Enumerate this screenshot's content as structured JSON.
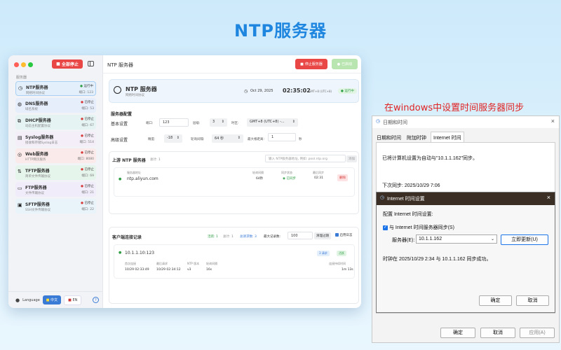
{
  "hero": {
    "title": "NTP服务器"
  },
  "caption": {
    "text": "在windows中设置时间服务器同步"
  },
  "mac": {
    "stop_all": "全部停止",
    "sidebar_heading": "服务器",
    "services": [
      {
        "name": "NTP服务器",
        "desc": "网络时间协议",
        "status": "运行中",
        "port": "端口: 123",
        "icon": "clock-icon",
        "color": "#2f9e44",
        "bg": "#e3f0fc"
      },
      {
        "name": "DNS服务器",
        "desc": "域名系统",
        "status": "已停止",
        "port": "端口: 53",
        "icon": "globe-icon",
        "color": "#d63b3b",
        "bg": "#e6eefb"
      },
      {
        "name": "DHCP服务器",
        "desc": "动态主机配置协议",
        "status": "已停止",
        "port": "端口: 67",
        "icon": "network-icon",
        "color": "#d63b3b",
        "bg": "#e5f3f3"
      },
      {
        "name": "Syslog服务器",
        "desc": "接收和存储Syslog日志",
        "status": "已停止",
        "port": "端口: 514",
        "icon": "document-icon",
        "color": "#d63b3b",
        "bg": "#f3eef8"
      },
      {
        "name": "Web服务器",
        "desc": "HTTP网页服务",
        "status": "已停止",
        "port": "端口: 8080",
        "icon": "web-icon",
        "color": "#d63b3b",
        "bg": "#fbeaea"
      },
      {
        "name": "TFTP服务器",
        "desc": "简单文件传输协议",
        "status": "已停止",
        "port": "端口: 69",
        "icon": "transfer-icon",
        "color": "#d63b3b",
        "bg": "#e6f5ec"
      },
      {
        "name": "FTP服务器",
        "desc": "文件传输协议",
        "status": "已停止",
        "port": "端口: 21",
        "icon": "folder-icon",
        "color": "#d63b3b",
        "bg": "#f1ecfa"
      },
      {
        "name": "SFTP服务器",
        "desc": "SSH文件传输协议",
        "status": "已停止",
        "port": "端口: 22",
        "icon": "lock-icon",
        "color": "#d63b3b",
        "bg": "#e8f3fa"
      }
    ],
    "language_label": "Language",
    "lang_zh": "中文",
    "lang_en": "EN",
    "help": "?",
    "main_title": "NTP 服务器",
    "stop_server": "停止服务器",
    "started": "已启动",
    "header_title": "NTP 服务器",
    "header_sub": "网络时间协议",
    "date": "Oct 29, 2025",
    "time": "02:35:02",
    "tz": "GMT+8 (UTC+8)",
    "running": "运行中",
    "config_title": "服务器配置",
    "basic_label": "基本设置",
    "port_label": "端口:",
    "port_value": "123",
    "stratum_label": "层级:",
    "stratum_value": "3",
    "tz_label": "时区:",
    "tz_value": "GMT+8 (UTC+8) -...",
    "advanced_label": "高级设置",
    "precision_label": "精度:",
    "precision_value": "-18",
    "poll_label": "轮询间隔:",
    "poll_value": "64 秒",
    "max_dist_label": "最大根距离:",
    "max_dist_value": "1",
    "sec_unit": "秒",
    "upstream_title": "上游 NTP 服务器",
    "upstream_count": "总计: 1",
    "upstream_placeholder": "输入 NTP服务器地址, 例如: pool.ntp.org",
    "add_btn": "添加",
    "upstream": {
      "addr_label": "服务器地址",
      "addr": "ntp.aliyun.com",
      "poll_label": "轮询间隔",
      "poll": "64秒",
      "sync_label": "同步状态",
      "sync": "已同步",
      "last_label": "最后同步",
      "last": "02:31",
      "delete": "删除"
    },
    "client_title": "客户端连接记录",
    "client_active": "活跃: 1",
    "client_total": "总计: 1",
    "client_req": "总请求数: 3",
    "max_records_label": "最大记录数:",
    "max_records_value": "100",
    "clear_btn": "清理过期",
    "enable_log": "启用日志",
    "client": {
      "ip": "10.1.1.10:123",
      "req_badge": "3 请求",
      "active_badge": "活跃",
      "first_label": "首次连接",
      "first": "10/29 02:33:49",
      "last_label": "最后请求",
      "last": "10/29 02:34:12",
      "ver_label": "NTP 版本",
      "ver": "v3",
      "poll_label": "轮询间隔",
      "poll": "16s",
      "dur_label": "连接持续时间",
      "dur": "1m 13s"
    }
  },
  "win_datetime": {
    "title": "日期和时间",
    "tabs": [
      "日期和时间",
      "附加时钟",
      "Internet 时间"
    ],
    "sync_text": "已将计算机设置为自动与\"10.1.1.162\"同步。",
    "next_sync": "下次同步: 2025/10/29 7:06",
    "ok": "确定",
    "cancel": "取消",
    "apply": "应用(A)"
  },
  "win_internet": {
    "title": "Internet 时间设置",
    "config_label": "配置 Internet 时间设置:",
    "checkbox_label": "与 Internet 时间服务器同步(S)",
    "server_label": "服务器(E):",
    "server_value": "10.1.1.162",
    "update_btn": "立即更新(U)",
    "result": "时钟在 2025/10/29 2:34 与 10.1.1.162 同步成功。",
    "ok": "确定",
    "cancel": "取消"
  }
}
